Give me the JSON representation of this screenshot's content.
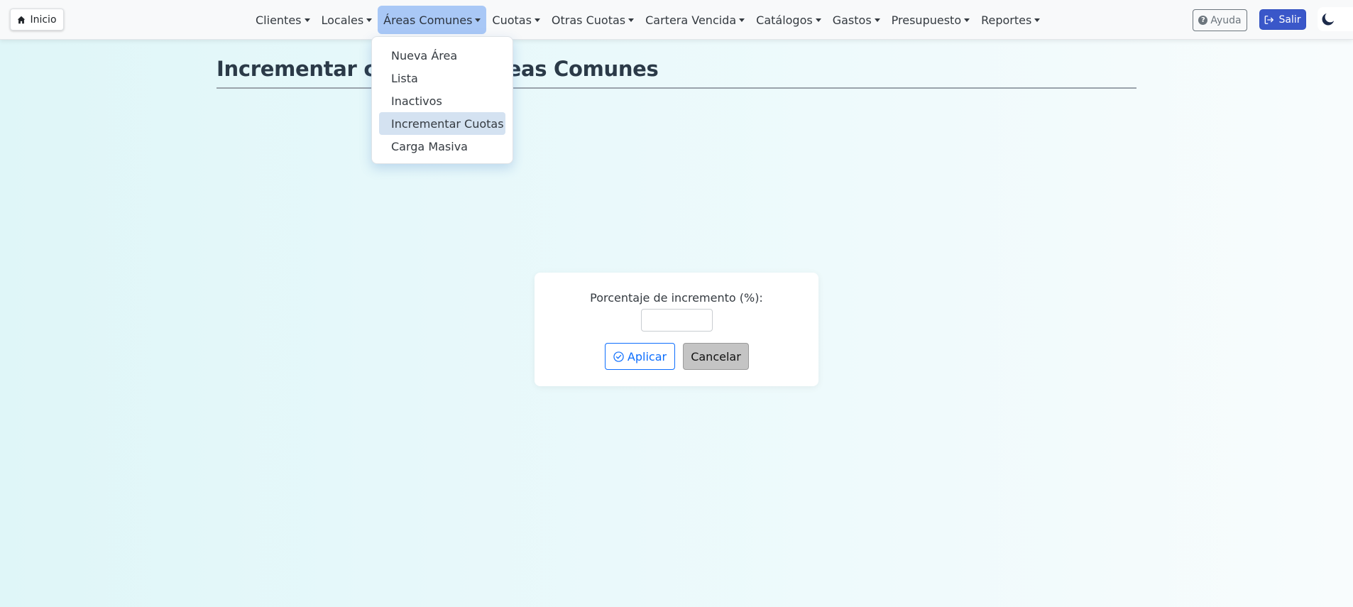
{
  "navbar": {
    "home_label": "Inicio",
    "menu": [
      {
        "label": "Clientes"
      },
      {
        "label": "Locales"
      },
      {
        "label": "Áreas Comunes"
      },
      {
        "label": "Cuotas"
      },
      {
        "label": "Otras Cuotas"
      },
      {
        "label": "Cartera Vencida"
      },
      {
        "label": "Catálogos"
      },
      {
        "label": "Gastos"
      },
      {
        "label": "Presupuesto"
      },
      {
        "label": "Reportes"
      }
    ],
    "active_menu": "Áreas Comunes",
    "help_label": "Ayuda",
    "exit_label": "Salir",
    "help_icon": "question-circle-icon",
    "exit_icon": "sign-out-icon",
    "theme_icon": "moon-icon",
    "home_icon": "house-icon"
  },
  "dropdown": {
    "items": [
      {
        "label": "Nueva Área"
      },
      {
        "label": "Lista"
      },
      {
        "label": "Inactivos"
      },
      {
        "label": "Incrementar Cuotas"
      },
      {
        "label": "Carga Masiva"
      }
    ],
    "selected": "Incrementar Cuotas"
  },
  "page": {
    "title": "Incrementar cuotas de Áreas Comunes"
  },
  "modal": {
    "label": "Porcentaje de incremento (%):",
    "input_value": "",
    "apply_label": "Aplicar",
    "cancel_label": "Cancelar",
    "apply_icon": "check-circle-icon"
  },
  "colors": {
    "active_menu_bg": "#a9c8f6",
    "exit_button_bg": "#3a57c9",
    "apply_border": "#0d6efd",
    "selected_item_bg": "#d4e2f1",
    "cancel_bg": "#c4c4c4"
  }
}
